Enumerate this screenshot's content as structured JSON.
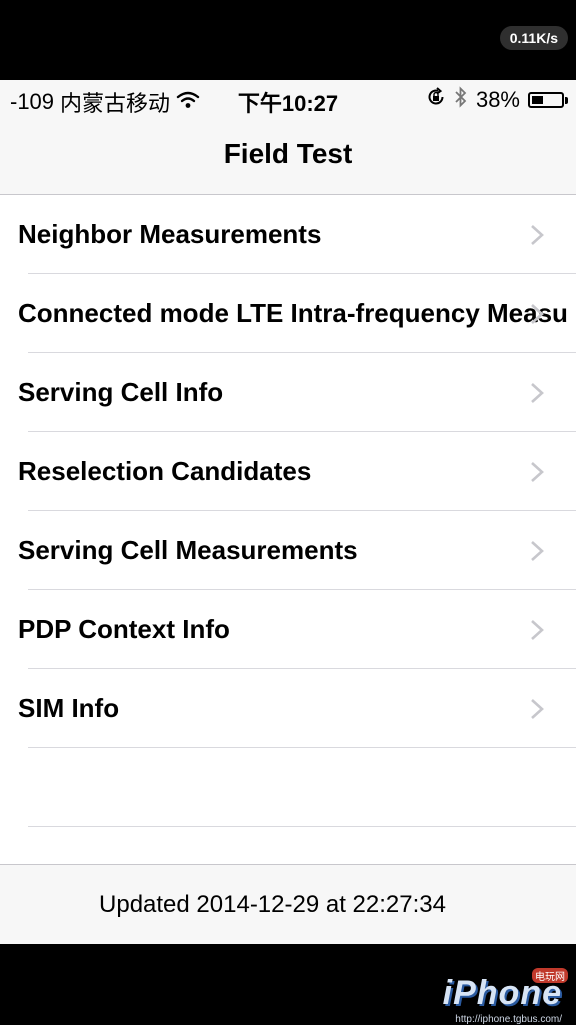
{
  "top_bar": {
    "network_speed": "0.11K/s"
  },
  "status_bar": {
    "signal": "-109",
    "carrier": "内蒙古移动",
    "time": "下午10:27",
    "battery_percent_text": "38%",
    "battery_level": 0.38
  },
  "nav": {
    "title": "Field Test"
  },
  "list": {
    "items": [
      {
        "label": "Neighbor Measurements"
      },
      {
        "label": "Connected mode LTE Intra-frequency Measu"
      },
      {
        "label": "Serving Cell Info"
      },
      {
        "label": "Reselection Candidates"
      },
      {
        "label": "Serving Cell Measurements"
      },
      {
        "label": "PDP Context Info"
      },
      {
        "label": "SIM Info"
      }
    ]
  },
  "footer": {
    "updated_text": "Updated 2014-12-29 at 22:27:34"
  },
  "watermark": {
    "logo": "iPhone",
    "badge": "电玩网",
    "url": "http://iphone.tgbus.com/"
  }
}
